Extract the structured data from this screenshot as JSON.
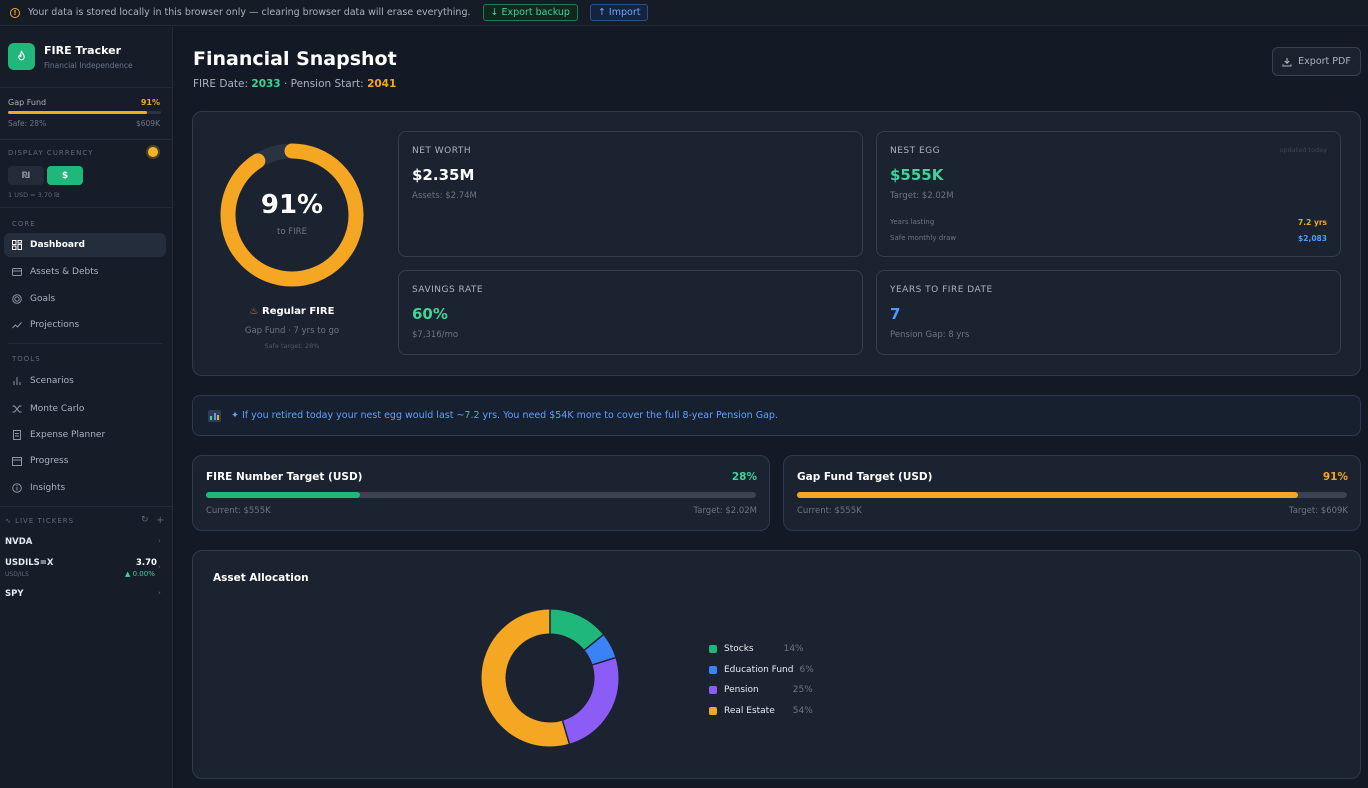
{
  "banner": {
    "warning_text": "Your data is stored locally in this browser only — clearing browser data will erase everything.",
    "export_label": "↓ Export backup",
    "import_label": "↑ Import"
  },
  "sidebar": {
    "app_title": "FIRE Tracker",
    "app_subtitle": "Financial Independence",
    "gap_fund": {
      "label": "Gap Fund",
      "percent": "91%",
      "progress": 0.91,
      "safe_label": "Safe: 28%",
      "target": "$609K"
    },
    "currency": {
      "section_label": "DISPLAY CURRENCY",
      "option_ils": "₪",
      "option_usd": "$",
      "rate_text": "1 USD = 3.70 ₪"
    },
    "core_label": "CORE",
    "core_items": [
      {
        "label": "Dashboard",
        "icon": "dashboard-icon",
        "active": true
      },
      {
        "label": "Assets & Debts",
        "icon": "wallet-icon"
      },
      {
        "label": "Goals",
        "icon": "target-icon"
      },
      {
        "label": "Projections",
        "icon": "trend-icon"
      }
    ],
    "tools_label": "TOOLS",
    "tools_items": [
      {
        "label": "Scenarios",
        "icon": "bar-chart-icon"
      },
      {
        "label": "Monte Carlo",
        "icon": "shuffle-icon"
      },
      {
        "label": "Expense Planner",
        "icon": "document-icon"
      },
      {
        "label": "Progress",
        "icon": "calendar-icon"
      },
      {
        "label": "Insights",
        "icon": "info-icon"
      }
    ],
    "tickers_label": "LIVE TICKERS",
    "tickers": [
      {
        "symbol": "NVDA"
      },
      {
        "symbol": "USDILS=X",
        "sub": "USD/ILS",
        "value": "3.70",
        "change": "▲ 0.00%"
      },
      {
        "symbol": "SPY"
      }
    ]
  },
  "header": {
    "title": "Financial Snapshot",
    "fire_date_label": "FIRE Date:",
    "fire_date": "2033",
    "pension_label": "· Pension Start:",
    "pension_start": "2041",
    "export_pdf": "Export PDF"
  },
  "fire_ring": {
    "percent_text": "91%",
    "percent_value": 0.91,
    "sub": "to FIRE",
    "status_icon": "fire-icon",
    "status": "Regular FIRE",
    "gap_text": "Gap Fund · 7 yrs to go",
    "safe_target": "Safe target: 28%"
  },
  "cards": {
    "net_worth": {
      "label": "NET WORTH",
      "value": "$2.35M",
      "sub": "Assets: $2.74M"
    },
    "nest_egg": {
      "label": "NEST EGG",
      "badge": "updated today",
      "value": "$555K",
      "sub": "Target: $2.02M",
      "years_lasting_label": "Years lasting",
      "years_lasting": "7.2 yrs",
      "safe_draw_label": "Safe monthly draw",
      "safe_draw": "$2,083"
    },
    "savings_rate": {
      "label": "SAVINGS RATE",
      "value": "60%",
      "sub": "$7,316/mo"
    },
    "years_to_fire": {
      "label": "YEARS TO FIRE DATE",
      "value": "7",
      "sub": "Pension Gap: 8 yrs"
    }
  },
  "insight": {
    "icon": "chart-icon",
    "text": "✦ If you retired today your nest egg would last ~7.2 yrs. You need $54K more to cover the full 8-year Pension Gap."
  },
  "progress": {
    "fire_number": {
      "title": "FIRE Number Target (USD)",
      "percent": "28%",
      "value": 0.28,
      "current": "Current: $555K",
      "target": "Target: $2.02M",
      "color": "#1fb87a"
    },
    "gap_fund": {
      "title": "Gap Fund Target (USD)",
      "percent": "91%",
      "value": 0.91,
      "current": "Current: $555K",
      "target": "Target: $609K",
      "color": "#f5a623"
    }
  },
  "chart_data": {
    "type": "pie",
    "title": "Asset Allocation",
    "categories": [
      "Stocks",
      "Education Fund",
      "Pension",
      "Real Estate"
    ],
    "values": [
      14,
      6,
      25,
      54
    ],
    "labels": [
      "14%",
      "6%",
      "25%",
      "54%"
    ],
    "colors": [
      "#1fb87a",
      "#3b82f6",
      "#8b5cf6",
      "#f5a623"
    ],
    "legend": "right"
  },
  "colors": {
    "accent_green": "#1fb87a",
    "accent_orange": "#f5a623",
    "accent_blue": "#4e9bff",
    "background": "#131a26"
  }
}
